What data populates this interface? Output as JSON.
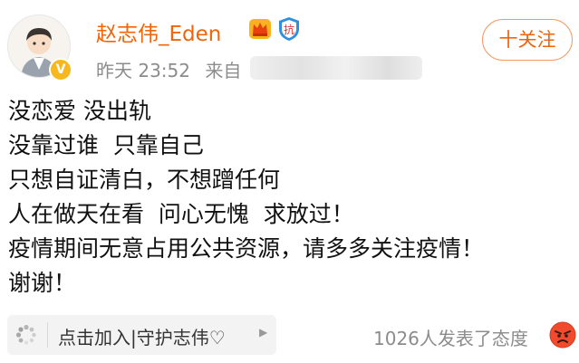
{
  "author": {
    "name": "赵志伟_Eden",
    "verified_badge": "V"
  },
  "meta": {
    "time": "昨天 23:52",
    "source_prefix": "来自"
  },
  "follow_button": {
    "label": "十关注"
  },
  "badges": {
    "shield_text": "抗"
  },
  "post": {
    "lines": [
      "没恋爱 没出轨",
      "没靠过谁  只靠自己",
      "只想自证清白，不想蹭任何",
      "人在做天在看  问心无愧  求放过！",
      "疫情期间无意占用公共资源，请多多关注疫情！",
      "谢谢！"
    ]
  },
  "group": {
    "label": "点击加入|守护志伟♡",
    "icon": "loading-dots-icon"
  },
  "reactions": {
    "summary": "1026人发表了态度",
    "icon": "angry-face-icon"
  },
  "colors": {
    "accent": "#f1640a",
    "meta": "#8c8c8c",
    "text": "#111111"
  }
}
